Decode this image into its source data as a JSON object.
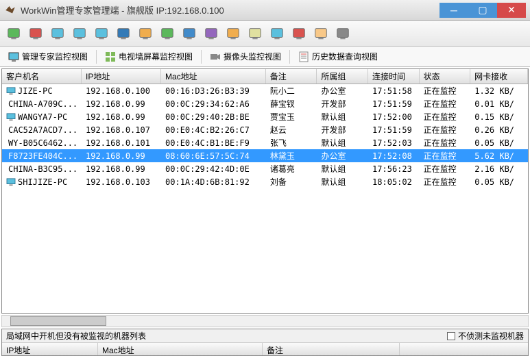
{
  "window": {
    "title": "WorkWin管理专家管理端 - 旗舰版 IP:192.168.0.100"
  },
  "toolbar_icons": [
    {
      "name": "add-icon",
      "color": "#5cb85c"
    },
    {
      "name": "remove-icon",
      "color": "#d9534f"
    },
    {
      "name": "monitor1-icon",
      "color": "#5bc0de"
    },
    {
      "name": "monitor2-icon",
      "color": "#5bc0de"
    },
    {
      "name": "monitor3-icon",
      "color": "#5bc0de"
    },
    {
      "name": "page-icon",
      "color": "#337ab7"
    },
    {
      "name": "pencil-icon",
      "color": "#f0ad4e"
    },
    {
      "name": "play-icon",
      "color": "#5cb85c"
    },
    {
      "name": "globe-icon",
      "color": "#428bca"
    },
    {
      "name": "find-icon",
      "color": "#9467bd"
    },
    {
      "name": "clock-icon",
      "color": "#f0ad4e"
    },
    {
      "name": "chat-icon",
      "color": "#e0e0a0"
    },
    {
      "name": "call-icon",
      "color": "#5bc0de"
    },
    {
      "name": "power-icon",
      "color": "#d9534f"
    },
    {
      "name": "user-icon",
      "color": "#f8c888"
    },
    {
      "name": "file-icon",
      "color": "#888"
    }
  ],
  "views": {
    "v1": "管理专家监控视图",
    "v2": "电视墙屏幕监控视图",
    "v3": "摄像头监控视图",
    "v4": "历史数据查询视图"
  },
  "columns": {
    "c0": "客户机名",
    "c1": "IP地址",
    "c2": "Mac地址",
    "c3": "备注",
    "c4": "所属组",
    "c5": "连接时间",
    "c6": "状态",
    "c7": "网卡接收"
  },
  "rows": [
    {
      "name": "JIZE-PC",
      "ip": "192.168.0.100",
      "mac": "00:16:D3:26:B3:39",
      "note": "阮小二",
      "group": "办公室",
      "time": "17:51:58",
      "status": "正在监控",
      "net": "1.32 KB/"
    },
    {
      "name": "CHINA-A709C...",
      "ip": "192.168.0.99",
      "mac": "00:0C:29:34:62:A6",
      "note": "薛宝钗",
      "group": "开发部",
      "time": "17:51:59",
      "status": "正在监控",
      "net": "0.01 KB/"
    },
    {
      "name": "WANGYA7-PC",
      "ip": "192.168.0.99",
      "mac": "00:0C:29:40:2B:BE",
      "note": "贾宝玉",
      "group": "默认组",
      "time": "17:52:00",
      "status": "正在监控",
      "net": "0.15 KB/"
    },
    {
      "name": "CAC52A7ACD7...",
      "ip": "192.168.0.107",
      "mac": "00:E0:4C:B2:26:C7",
      "note": "赵云",
      "group": "开发部",
      "time": "17:51:59",
      "status": "正在监控",
      "net": "0.26 KB/"
    },
    {
      "name": "WY-B05C6462...",
      "ip": "192.168.0.101",
      "mac": "00:E0:4C:B1:BE:F9",
      "note": "张飞",
      "group": "默认组",
      "time": "17:52:03",
      "status": "正在监控",
      "net": "0.05 KB/"
    },
    {
      "name": "F8723FE404C...",
      "ip": "192.168.0.99",
      "mac": "08:60:6E:57:5C:74",
      "note": "林黛玉",
      "group": "办公室",
      "time": "17:52:08",
      "status": "正在监控",
      "net": "5.62 KB/",
      "selected": true
    },
    {
      "name": "CHINA-B3C95...",
      "ip": "192.168.0.99",
      "mac": "00:0C:29:42:4D:0E",
      "note": "诸葛亮",
      "group": "默认组",
      "time": "17:56:23",
      "status": "正在监控",
      "net": "2.16 KB/"
    },
    {
      "name": "SHIJIZE-PC",
      "ip": "192.168.0.103",
      "mac": "00:1A:4D:6B:81:92",
      "note": "刘备",
      "group": "默认组",
      "time": "18:05:02",
      "status": "正在监控",
      "net": "0.05 KB/"
    }
  ],
  "bottom": {
    "label": "局域网中开机但没有被监视的机器列表",
    "checkbox_label": "不侦测未监视机器",
    "c0": "IP地址",
    "c1": "Mac地址",
    "c2": "备注"
  }
}
